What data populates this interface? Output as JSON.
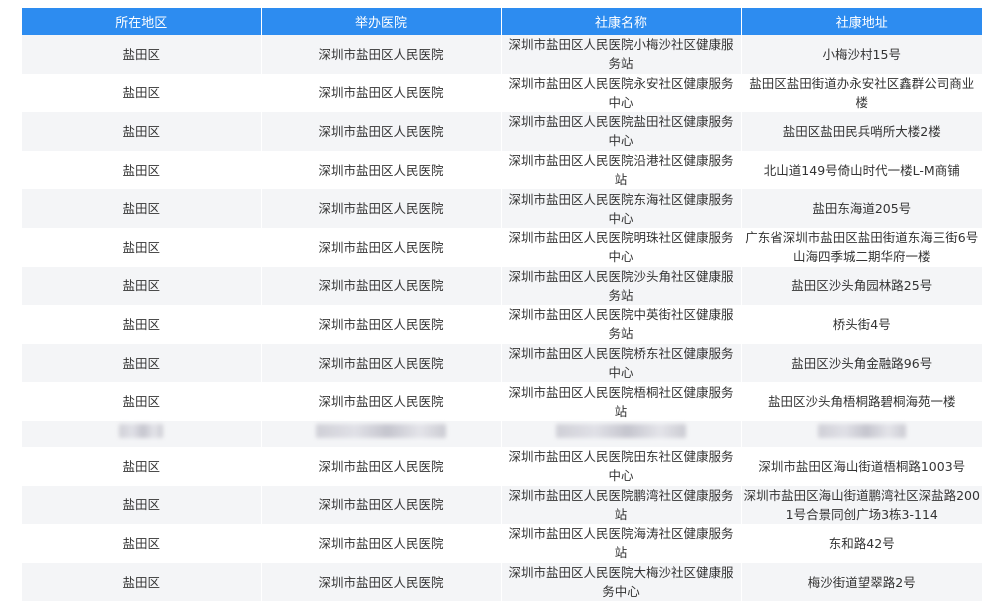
{
  "table": {
    "headers": [
      "所在地区",
      "举办医院",
      "社康名称",
      "社康地址"
    ],
    "rows": [
      {
        "district": "盐田区",
        "hospital": "深圳市盐田区人民医院",
        "name": "深圳市盐田区人民医院小梅沙社区健康服务站",
        "address": "小梅沙村15号"
      },
      {
        "district": "盐田区",
        "hospital": "深圳市盐田区人民医院",
        "name": "深圳市盐田区人民医院永安社区健康服务中心",
        "address": "盐田区盐田街道办永安社区鑫群公司商业楼"
      },
      {
        "district": "盐田区",
        "hospital": "深圳市盐田区人民医院",
        "name": "深圳市盐田区人民医院盐田社区健康服务中心",
        "address": "盐田区盐田民兵哨所大楼2楼"
      },
      {
        "district": "盐田区",
        "hospital": "深圳市盐田区人民医院",
        "name": "深圳市盐田区人民医院沿港社区健康服务站",
        "address": "北山道149号倚山时代一楼L-M商铺"
      },
      {
        "district": "盐田区",
        "hospital": "深圳市盐田区人民医院",
        "name": "深圳市盐田区人民医院东海社区健康服务中心",
        "address": "盐田东海道205号"
      },
      {
        "district": "盐田区",
        "hospital": "深圳市盐田区人民医院",
        "name": "深圳市盐田区人民医院明珠社区健康服务中心",
        "address": "广东省深圳市盐田区盐田街道东海三街6号山海四季城二期华府一楼"
      },
      {
        "district": "盐田区",
        "hospital": "深圳市盐田区人民医院",
        "name": "深圳市盐田区人民医院沙头角社区健康服务站",
        "address": "盐田区沙头角园林路25号"
      },
      {
        "district": "盐田区",
        "hospital": "深圳市盐田区人民医院",
        "name": "深圳市盐田区人民医院中英街社区健康服务站",
        "address": "桥头街4号"
      },
      {
        "district": "盐田区",
        "hospital": "深圳市盐田区人民医院",
        "name": "深圳市盐田区人民医院桥东社区健康服务中心",
        "address": "盐田区沙头角金融路96号"
      },
      {
        "district": "盐田区",
        "hospital": "深圳市盐田区人民医院",
        "name": "深圳市盐田区人民医院梧桐社区健康服务站",
        "address": "盐田区沙头角梧桐路碧桐海苑一楼"
      }
    ],
    "rows_after": [
      {
        "district": "盐田区",
        "hospital": "深圳市盐田区人民医院",
        "name": "深圳市盐田区人民医院田东社区健康服务中心",
        "address": "深圳市盐田区海山街道梧桐路1003号"
      },
      {
        "district": "盐田区",
        "hospital": "深圳市盐田区人民医院",
        "name": "深圳市盐田区人民医院鹏湾社区健康服务站",
        "address": "深圳市盐田区海山街道鹏湾社区深盐路2001号合景同创广场3栋3-114"
      },
      {
        "district": "盐田区",
        "hospital": "深圳市盐田区人民医院",
        "name": "深圳市盐田区人民医院海涛社区健康服务站",
        "address": "东和路42号"
      },
      {
        "district": "盐田区",
        "hospital": "深圳市盐田区人民医院",
        "name": "深圳市盐田区人民医院大梅沙社区健康服务中心",
        "address": "梅沙街道望翠路2号"
      }
    ]
  }
}
